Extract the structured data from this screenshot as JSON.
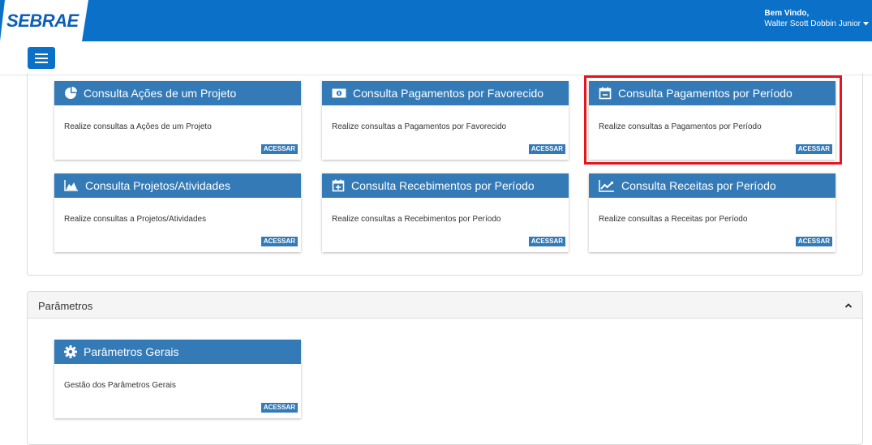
{
  "header": {
    "logo": "SEBRAE",
    "greeting": "Bem Vindo,",
    "user_name": "Walter Scott Dobbin Junior"
  },
  "menu": {
    "icon": "hamburger-menu-icon"
  },
  "cards": [
    {
      "title": "Consulta Ações de um Projeto",
      "desc": "Realize consultas a Ações de um Projeto",
      "button": "ACESSAR",
      "icon": "pie-chart-icon"
    },
    {
      "title": "Consulta Pagamentos por Favorecido",
      "desc": "Realize consultas a Pagamentos por Favorecido",
      "button": "ACESSAR",
      "icon": "money-icon"
    },
    {
      "title": "Consulta Pagamentos por Período",
      "desc": "Realize consultas a Pagamentos por Período",
      "button": "ACESSAR",
      "icon": "calendar-minus-icon"
    },
    {
      "title": "Consulta Projetos/Atividades",
      "desc": "Realize consultas a Projetos/Atividades",
      "button": "ACESSAR",
      "icon": "area-chart-icon"
    },
    {
      "title": "Consulta Recebimentos por Período",
      "desc": "Realize consultas a Recebimentos por Período",
      "button": "ACESSAR",
      "icon": "calendar-plus-icon"
    },
    {
      "title": "Consulta Receitas por Período",
      "desc": "Realize consultas a Receitas por Período",
      "button": "ACESSAR",
      "icon": "line-chart-icon"
    }
  ],
  "parametros": {
    "title": "Parâmetros",
    "card": {
      "title": "Parâmetros Gerais",
      "desc": "Gestão dos Parâmetros Gerais",
      "button": "ACESSAR",
      "icon": "gear-icon"
    }
  },
  "colors": {
    "header": "#0b70c8",
    "card_head": "#337ab7",
    "highlight": "#e8141c"
  }
}
